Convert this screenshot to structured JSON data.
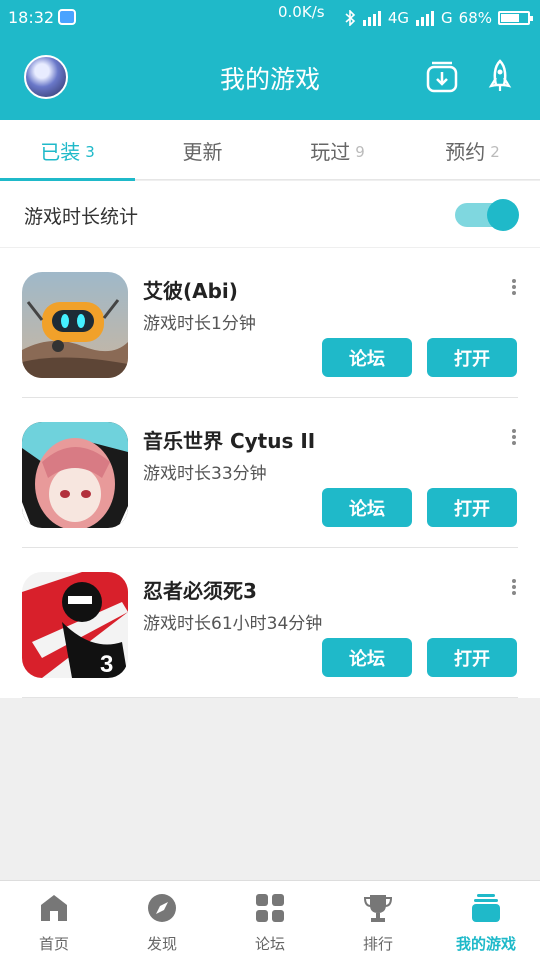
{
  "status_bar": {
    "time": "18:32",
    "net_speed": "0.0K/s",
    "network": "4G",
    "network2": "G",
    "battery": "68%",
    "battery_level": 0.68
  },
  "header": {
    "title": "我的游戏",
    "icons": [
      "avatar",
      "download-icon",
      "rocket-icon"
    ]
  },
  "tabs": [
    {
      "label": "已装",
      "count": "3",
      "active": true
    },
    {
      "label": "更新",
      "count": "",
      "active": false
    },
    {
      "label": "玩过",
      "count": "9",
      "active": false
    },
    {
      "label": "预约",
      "count": "2",
      "active": false
    }
  ],
  "stats": {
    "label": "游戏时长统计",
    "toggle_on": true
  },
  "games": [
    {
      "name": "艾彼(Abi)",
      "time": "游戏时长1分钟",
      "forum": "论坛",
      "open": "打开"
    },
    {
      "name": "音乐世界 Cytus II",
      "time": "游戏时长33分钟",
      "forum": "论坛",
      "open": "打开"
    },
    {
      "name": "忍者必须死3",
      "time": "游戏时长61小时34分钟",
      "forum": "论坛",
      "open": "打开",
      "icon_badge": "3"
    }
  ],
  "bottom_nav": [
    {
      "label": "首页",
      "icon": "home-icon"
    },
    {
      "label": "发现",
      "icon": "compass-icon"
    },
    {
      "label": "论坛",
      "icon": "grid-icon"
    },
    {
      "label": "排行",
      "icon": "trophy-icon"
    },
    {
      "label": "我的游戏",
      "icon": "games-stack-icon",
      "active": true
    }
  ],
  "colors": {
    "accent": "#1fb9c9",
    "accent_light": "#7fd7df",
    "background": "#efefef"
  }
}
